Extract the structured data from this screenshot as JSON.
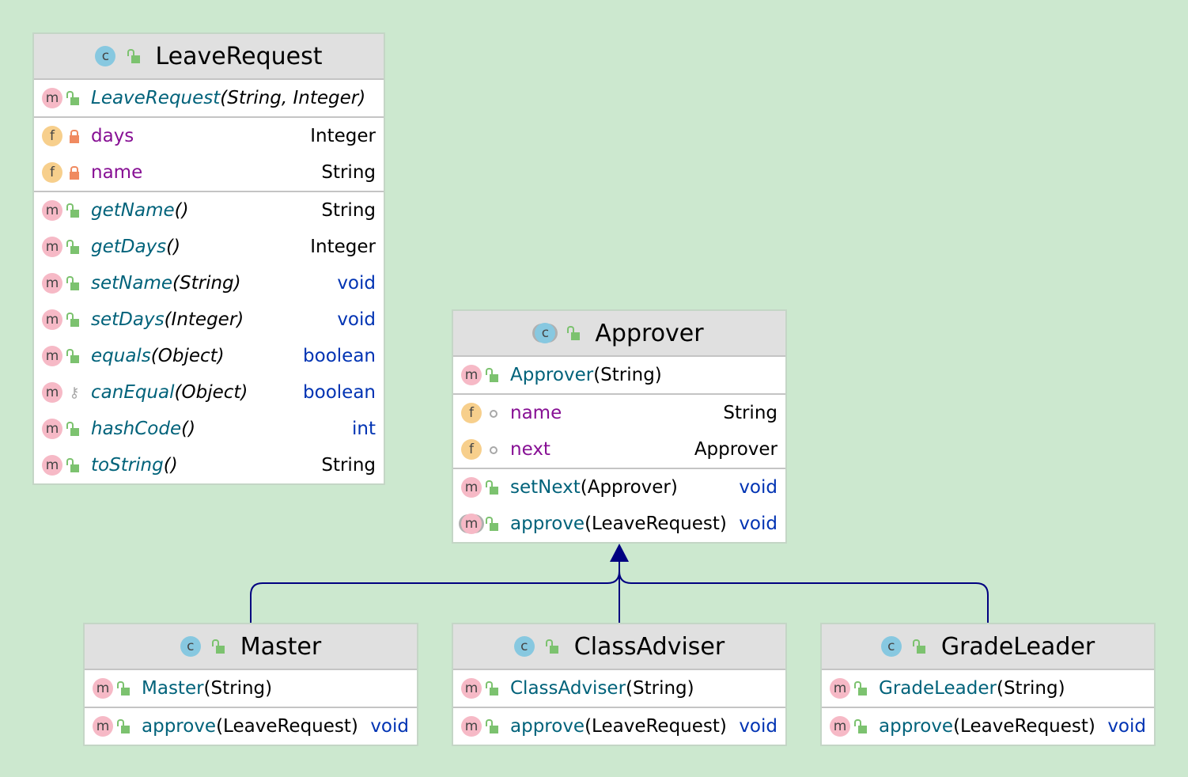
{
  "colors": {
    "background": "#cce8cf",
    "arrow": "#000080",
    "method": "#00627a",
    "field": "#871094",
    "keyword": "#0033b3"
  },
  "classes": [
    {
      "id": "LeaveRequest",
      "name": "LeaveRequest",
      "abstract": false,
      "constructors": [
        {
          "name": "LeaveRequest",
          "params": "(String, Integer)",
          "vis": "public",
          "italic": true
        }
      ],
      "fields": [
        {
          "name": "days",
          "type": "Integer",
          "vis": "private"
        },
        {
          "name": "name",
          "type": "String",
          "vis": "private"
        }
      ],
      "methods": [
        {
          "name": "getName",
          "params": "()",
          "type": "String",
          "vis": "public",
          "italic": true
        },
        {
          "name": "getDays",
          "params": "()",
          "type": "Integer",
          "vis": "public",
          "italic": true
        },
        {
          "name": "setName",
          "params": "(String)",
          "type": "void",
          "vis": "public",
          "italic": true
        },
        {
          "name": "setDays",
          "params": "(Integer)",
          "type": "void",
          "vis": "public",
          "italic": true
        },
        {
          "name": "equals",
          "params": "(Object)",
          "type": "boolean",
          "vis": "public",
          "italic": true
        },
        {
          "name": "canEqual",
          "params": "(Object)",
          "type": "boolean",
          "vis": "protected",
          "italic": true
        },
        {
          "name": "hashCode",
          "params": "()",
          "type": "int",
          "vis": "public",
          "italic": true
        },
        {
          "name": "toString",
          "params": "()",
          "type": "String",
          "vis": "public",
          "italic": true
        }
      ]
    },
    {
      "id": "Approver",
      "name": "Approver",
      "abstract": true,
      "constructors": [
        {
          "name": "Approver",
          "params": "(String)",
          "vis": "public"
        }
      ],
      "fields": [
        {
          "name": "name",
          "type": "String",
          "vis": "package"
        },
        {
          "name": "next",
          "type": "Approver",
          "vis": "package"
        }
      ],
      "methods": [
        {
          "name": "setNext",
          "params": "(Approver)",
          "type": "void",
          "vis": "public"
        },
        {
          "name": "approve",
          "params": "(LeaveRequest)",
          "type": "void",
          "vis": "public",
          "abstract": true
        }
      ]
    },
    {
      "id": "Master",
      "name": "Master",
      "abstract": false,
      "constructors": [
        {
          "name": "Master",
          "params": "(String)",
          "vis": "public"
        }
      ],
      "fields": [],
      "methods": [
        {
          "name": "approve",
          "params": "(LeaveRequest)",
          "type": "void",
          "vis": "public"
        }
      ]
    },
    {
      "id": "ClassAdviser",
      "name": "ClassAdviser",
      "abstract": false,
      "constructors": [
        {
          "name": "ClassAdviser",
          "params": "(String)",
          "vis": "public"
        }
      ],
      "fields": [],
      "methods": [
        {
          "name": "approve",
          "params": "(LeaveRequest)",
          "type": "void",
          "vis": "public"
        }
      ]
    },
    {
      "id": "GradeLeader",
      "name": "GradeLeader",
      "abstract": false,
      "constructors": [
        {
          "name": "GradeLeader",
          "params": "(String)",
          "vis": "public"
        }
      ],
      "fields": [],
      "methods": [
        {
          "name": "approve",
          "params": "(LeaveRequest)",
          "type": "void",
          "vis": "public"
        }
      ]
    }
  ],
  "relations": [
    {
      "type": "inheritance",
      "from": "Master",
      "to": "Approver"
    },
    {
      "type": "inheritance",
      "from": "ClassAdviser",
      "to": "Approver"
    },
    {
      "type": "inheritance",
      "from": "GradeLeader",
      "to": "Approver"
    }
  ]
}
